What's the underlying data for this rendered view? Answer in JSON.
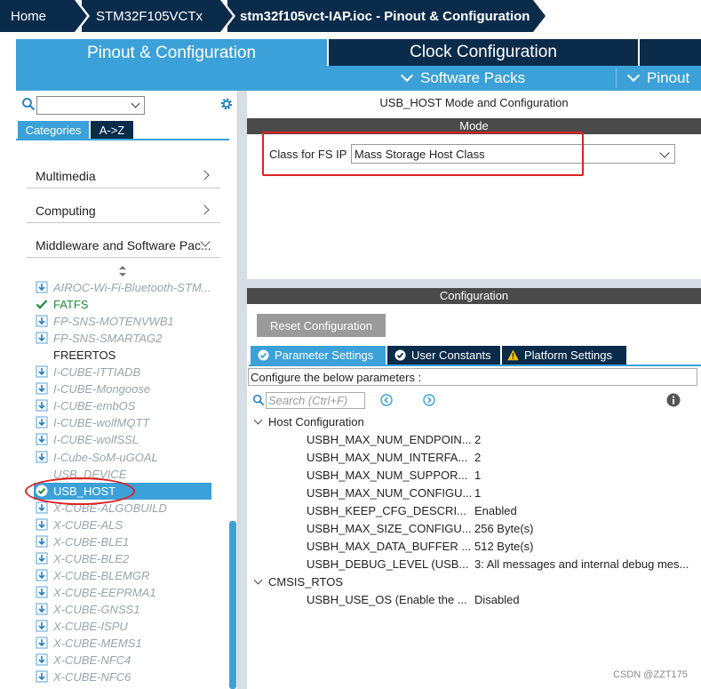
{
  "breadcrumb": [
    {
      "label": "Home"
    },
    {
      "label": "STM32F105VCTx"
    },
    {
      "label": "stm32f105vct-IAP.ioc - Pinout & Configuration"
    }
  ],
  "tabs": {
    "pinout_config": "Pinout & Configuration",
    "clock_config": "Clock Configuration",
    "software_packs": "Software Packs",
    "pinout": "Pinout"
  },
  "left": {
    "search_placeholder": "",
    "tab_categories": "Categories",
    "tab_az": "A->Z",
    "categories": [
      "Multimedia",
      "Computing",
      "Middleware and Software Pac..."
    ],
    "items": [
      {
        "label": "AIROC-Wi-Fi-Bluetooth-STM...",
        "state": "pack"
      },
      {
        "label": "FATFS",
        "state": "enabled"
      },
      {
        "label": "FP-SNS-MOTENVWB1",
        "state": "pack"
      },
      {
        "label": "FP-SNS-SMARTAG2",
        "state": "pack"
      },
      {
        "label": "FREERTOS",
        "state": "plain"
      },
      {
        "label": "I-CUBE-ITTIADB",
        "state": "pack"
      },
      {
        "label": "I-CUBE-Mongoose",
        "state": "pack"
      },
      {
        "label": "I-CUBE-embOS",
        "state": "pack"
      },
      {
        "label": "I-CUBE-wolfMQTT",
        "state": "pack"
      },
      {
        "label": "I-CUBE-wolfSSL",
        "state": "pack"
      },
      {
        "label": "I-Cube-SoM-uGOAL",
        "state": "pack"
      },
      {
        "label": "USB_DEVICE",
        "state": "none"
      },
      {
        "label": "USB_HOST",
        "state": "selected"
      },
      {
        "label": "X-CUBE-ALGOBUILD",
        "state": "pack"
      },
      {
        "label": "X-CUBE-ALS",
        "state": "pack"
      },
      {
        "label": "X-CUBE-BLE1",
        "state": "pack"
      },
      {
        "label": "X-CUBE-BLE2",
        "state": "pack"
      },
      {
        "label": "X-CUBE-BLEMGR",
        "state": "pack"
      },
      {
        "label": "X-CUBE-EEPRMA1",
        "state": "pack"
      },
      {
        "label": "X-CUBE-GNSS1",
        "state": "pack"
      },
      {
        "label": "X-CUBE-ISPU",
        "state": "pack"
      },
      {
        "label": "X-CUBE-MEMS1",
        "state": "pack"
      },
      {
        "label": "X-CUBE-NFC4",
        "state": "pack"
      },
      {
        "label": "X-CUBE-NFC6",
        "state": "pack"
      }
    ]
  },
  "right": {
    "title": "USB_HOST Mode and Configuration",
    "mode_header": "Mode",
    "class_label": "Class for FS IP",
    "class_value": "Mass Storage Host Class",
    "config_header": "Configuration",
    "reset_button": "Reset Configuration",
    "param_tabs": [
      "Parameter Settings",
      "User Constants",
      "Platform Settings"
    ],
    "configure_text": "Configure the below parameters :",
    "search_placeholder": "Search (Ctrl+F)",
    "groups": [
      {
        "name": "Host Configuration",
        "params": [
          {
            "name": "USBH_MAX_NUM_ENDPOIN...",
            "value": "2"
          },
          {
            "name": "USBH_MAX_NUM_INTERFA...",
            "value": "2"
          },
          {
            "name": "USBH_MAX_NUM_SUPPOR...",
            "value": "1"
          },
          {
            "name": "USBH_MAX_NUM_CONFIGU...",
            "value": "1"
          },
          {
            "name": "USBH_KEEP_CFG_DESCRI...",
            "value": "Enabled"
          },
          {
            "name": "USBH_MAX_SIZE_CONFIGU...",
            "value": "256 Byte(s)"
          },
          {
            "name": "USBH_MAX_DATA_BUFFER ...",
            "value": "512 Byte(s)"
          },
          {
            "name": "USBH_DEBUG_LEVEL (USB...",
            "value": "3: All messages and internal debug mes..."
          }
        ]
      },
      {
        "name": "CMSIS_RTOS",
        "params": [
          {
            "name": "USBH_USE_OS (Enable the ...",
            "value": "Disabled"
          }
        ]
      }
    ]
  },
  "watermark": "CSDN @ZZT175",
  "colors": {
    "navy": "#0b2b4b",
    "accent": "#3ba1d8",
    "enabled_green": "#1a8f3a",
    "highlight_red": "#e02020"
  }
}
